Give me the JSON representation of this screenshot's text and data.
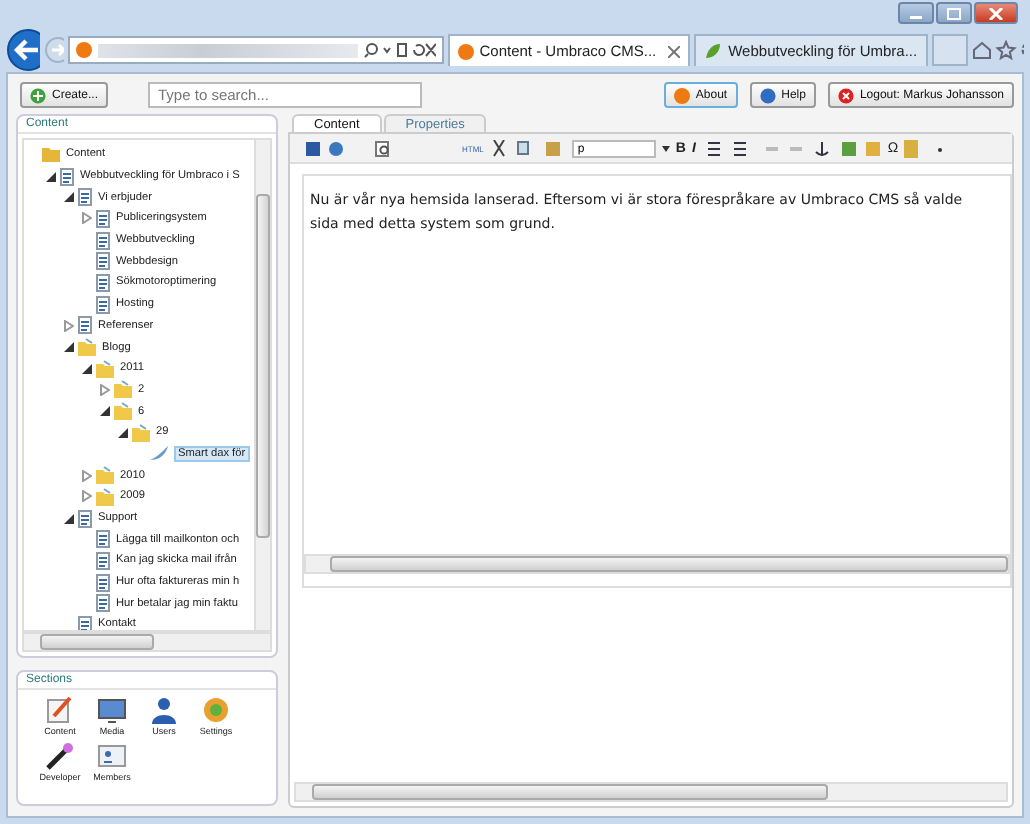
{
  "browser": {
    "tabs": [
      {
        "label": "Content - Umbraco CMS...",
        "selected": true
      },
      {
        "label": "Webbutveckling för Umbra...",
        "selected": false
      }
    ]
  },
  "toolbar": {
    "create": "Create...",
    "search_placeholder": "Type to search...",
    "about": "About",
    "help": "Help",
    "logout": "Logout: Markus Johansson"
  },
  "content_panel": {
    "title": "Content",
    "tree": [
      {
        "label": "Content",
        "kind": "root",
        "selected": false,
        "children": [
          {
            "label": "Webbutveckling för Umbraco i S",
            "kind": "page",
            "expanded": true,
            "selected": false,
            "children": [
              {
                "label": "Vi erbjuder",
                "kind": "page",
                "expanded": true,
                "selected": false,
                "children": [
                  {
                    "label": "Publiceringsystem",
                    "kind": "page",
                    "expanded": false,
                    "selected": false
                  },
                  {
                    "label": "Webbutveckling",
                    "kind": "page",
                    "selected": false
                  },
                  {
                    "label": "Webbdesign",
                    "kind": "page",
                    "selected": false
                  },
                  {
                    "label": "Sökmotoroptimering",
                    "kind": "page",
                    "selected": false
                  },
                  {
                    "label": "Hosting",
                    "kind": "page",
                    "selected": false
                  }
                ]
              },
              {
                "label": "Referenser",
                "kind": "page",
                "expanded": false,
                "selected": false
              },
              {
                "label": "Blogg",
                "kind": "folder",
                "expanded": true,
                "selected": false,
                "children": [
                  {
                    "label": "2011",
                    "kind": "folder",
                    "expanded": true,
                    "selected": false,
                    "children": [
                      {
                        "label": "2",
                        "kind": "folder",
                        "expanded": false,
                        "selected": false
                      },
                      {
                        "label": "6",
                        "kind": "folder",
                        "expanded": true,
                        "selected": false,
                        "children": [
                          {
                            "label": "29",
                            "kind": "folder",
                            "expanded": true,
                            "selected": false,
                            "children": [
                              {
                                "label": "Smart dax för",
                                "kind": "post",
                                "selected": true
                              }
                            ]
                          }
                        ]
                      }
                    ]
                  },
                  {
                    "label": "2010",
                    "kind": "folder",
                    "expanded": false,
                    "selected": false
                  },
                  {
                    "label": "2009",
                    "kind": "folder",
                    "expanded": false,
                    "selected": false
                  }
                ]
              },
              {
                "label": "Support",
                "kind": "page",
                "expanded": true,
                "selected": false,
                "children": [
                  {
                    "label": "Lägga till mailkonton och",
                    "kind": "page",
                    "selected": false
                  },
                  {
                    "label": "Kan jag skicka mail ifrån",
                    "kind": "page",
                    "selected": false
                  },
                  {
                    "label": "Hur ofta faktureras min h",
                    "kind": "page",
                    "selected": false
                  },
                  {
                    "label": "Hur betalar jag min faktu",
                    "kind": "page",
                    "selected": false
                  }
                ]
              },
              {
                "label": "Kontakt",
                "kind": "page",
                "selected": false
              }
            ]
          }
        ]
      }
    ]
  },
  "sections": {
    "title": "Sections",
    "items": [
      {
        "label": "Content"
      },
      {
        "label": "Media"
      },
      {
        "label": "Users"
      },
      {
        "label": "Settings"
      },
      {
        "label": "Developer"
      },
      {
        "label": "Members"
      }
    ]
  },
  "editor": {
    "tabs": [
      {
        "label": "Content",
        "selected": true
      },
      {
        "label": "Properties",
        "selected": false
      }
    ],
    "toolbar": {
      "html": "HTML",
      "format": "p",
      "bold": "B",
      "italic": "I",
      "special_char": "Ω"
    },
    "text": "Nu är vår nya hemsida lanserad. Eftersom vi är stora förespråkare av Umbraco CMS så valde\nsida med detta system som grund."
  }
}
